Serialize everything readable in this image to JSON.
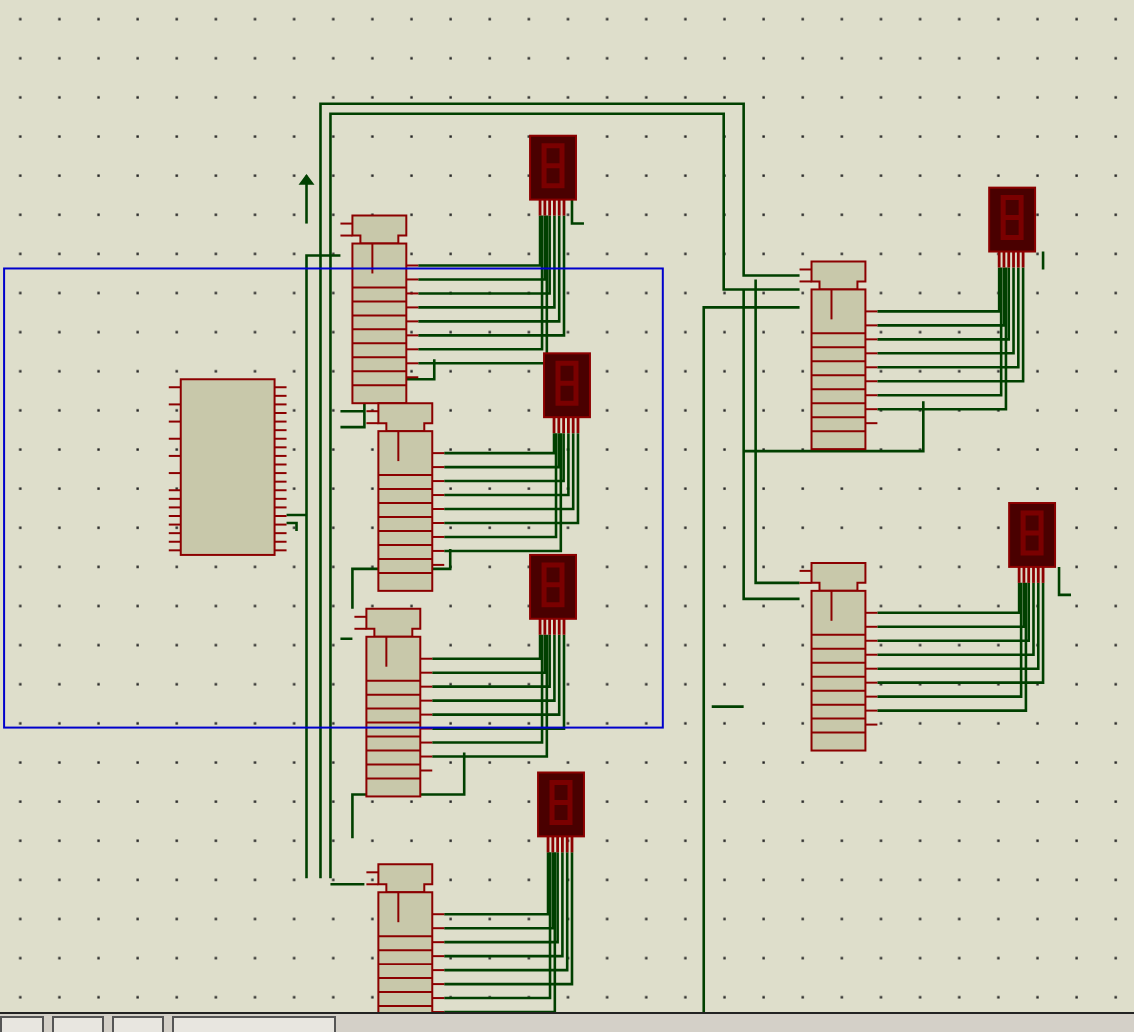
{
  "schematic": {
    "components": [
      {
        "kind": "mcu"
      },
      {
        "kind": "latch"
      },
      {
        "kind": "latch"
      },
      {
        "kind": "latch"
      },
      {
        "kind": "latch"
      },
      {
        "kind": "latch"
      },
      {
        "kind": "latch"
      },
      {
        "kind": "display"
      },
      {
        "kind": "display"
      },
      {
        "kind": "display"
      },
      {
        "kind": "display"
      },
      {
        "kind": "display"
      },
      {
        "kind": "display"
      }
    ],
    "selection_box": {
      "visible": true
    }
  },
  "status_bar": {
    "buttons": [
      {
        "kind": "plain"
      },
      {
        "kind": "pause"
      },
      {
        "kind": "stop"
      },
      {
        "kind": "message"
      }
    ]
  }
}
